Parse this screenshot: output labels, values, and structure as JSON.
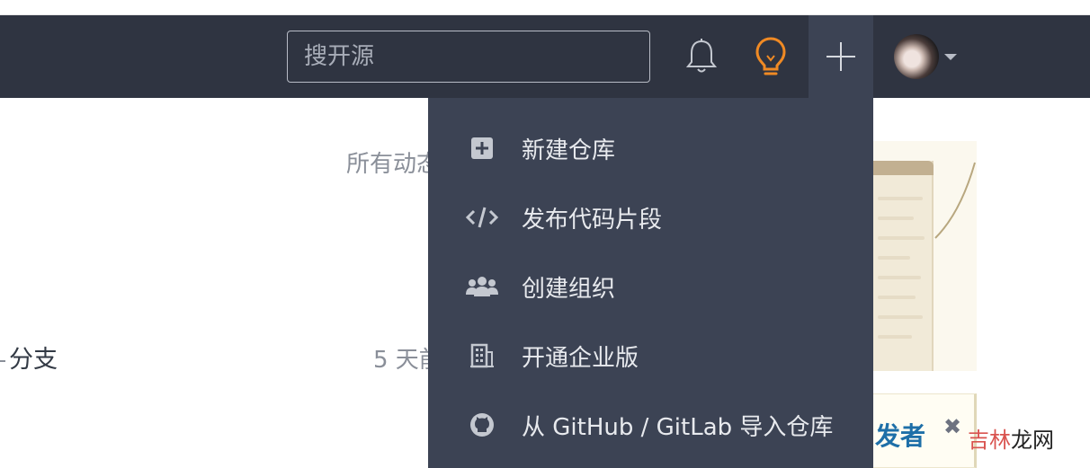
{
  "navbar": {
    "search_placeholder": "搜开源"
  },
  "background": {
    "all_activity": "所有动态",
    "branch_label": "分支",
    "time_ago": "5 天前"
  },
  "dropdown": {
    "items": [
      {
        "label": "新建仓库",
        "icon": "plus-square-icon"
      },
      {
        "label": "发布代码片段",
        "icon": "code-icon"
      },
      {
        "label": "创建组织",
        "icon": "users-icon"
      },
      {
        "label": "开通企业版",
        "icon": "building-icon"
      },
      {
        "label": "从 GitHub / GitLab 导入仓库",
        "icon": "github-icon"
      }
    ]
  },
  "promo": {
    "text": "发者",
    "close": "✖"
  },
  "watermark": {
    "part1": "吉林",
    "part2": "龙网"
  },
  "colors": {
    "navbar_bg": "#2f3441",
    "dropdown_bg": "#3c4354",
    "bulb_accent": "#f08a24"
  }
}
